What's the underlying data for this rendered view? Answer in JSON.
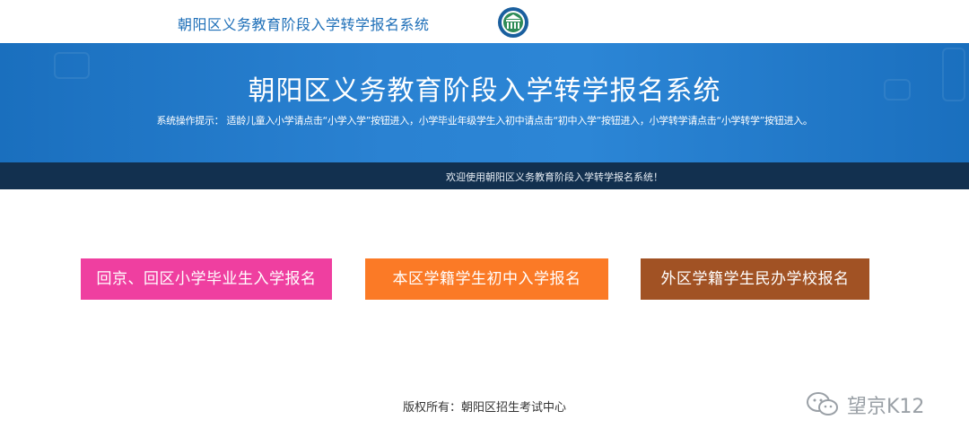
{
  "header": {
    "title": "朝阳区义务教育阶段入学转学报名系统",
    "logo_icon": "school-emblem-icon"
  },
  "banner": {
    "title": "朝阳区义务教育阶段入学转学报名系统",
    "hint": "系统操作提示： 适龄儿童入小学请点击“小学入学”按钮进入，小学毕业年级学生入初中请点击“初中入学”按钮进入，小学转学请点击“小学转学”按钮进入。",
    "color": "#2a82d2"
  },
  "welcome": {
    "text": "欢迎使用朝阳区义务教育阶段入学转学报名系统！"
  },
  "actions": [
    {
      "label": "回京、回区小学毕业生入学报名",
      "color": "#ef3fa0"
    },
    {
      "label": "本区学籍学生初中入学报名",
      "color": "#fb7a26"
    },
    {
      "label": "外区学籍学生民办学校报名",
      "color": "#a15224"
    }
  ],
  "footer": {
    "copyright": "版权所有：朝阳区招生考试中心"
  },
  "watermark": {
    "text": "望京K12",
    "icon": "wechat-icon"
  }
}
